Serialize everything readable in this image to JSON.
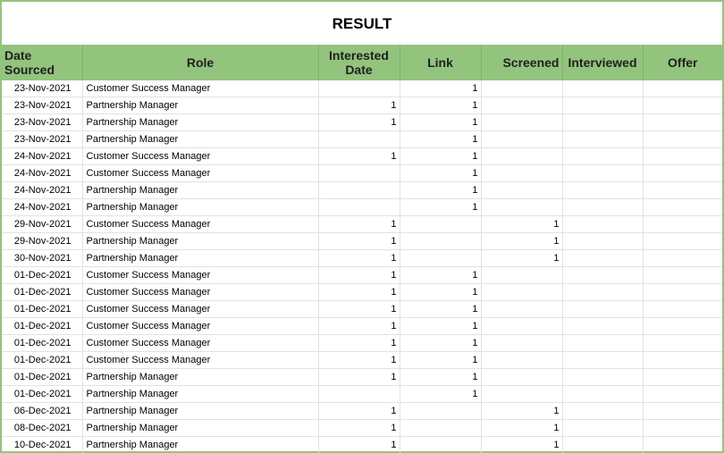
{
  "title": "RESULT",
  "colors": {
    "header_bg": "#93c47d",
    "border": "#93c47d",
    "grid": "#e2e2e2"
  },
  "columns": [
    "Date Sourced",
    "Role",
    "Interested Date",
    "Link",
    "Screened",
    "Interviewed",
    "Offer"
  ],
  "rows": [
    {
      "date": "23-Nov-2021",
      "role": "Customer Success Manager",
      "interested": "",
      "link": "1",
      "screened": "",
      "interviewed": "",
      "offer": ""
    },
    {
      "date": "23-Nov-2021",
      "role": "Partnership Manager",
      "interested": "1",
      "link": "1",
      "screened": "",
      "interviewed": "",
      "offer": ""
    },
    {
      "date": "23-Nov-2021",
      "role": "Partnership Manager",
      "interested": "1",
      "link": "1",
      "screened": "",
      "interviewed": "",
      "offer": ""
    },
    {
      "date": "23-Nov-2021",
      "role": "Partnership Manager",
      "interested": "",
      "link": "1",
      "screened": "",
      "interviewed": "",
      "offer": ""
    },
    {
      "date": "24-Nov-2021",
      "role": "Customer Success Manager",
      "interested": "1",
      "link": "1",
      "screened": "",
      "interviewed": "",
      "offer": ""
    },
    {
      "date": "24-Nov-2021",
      "role": "Customer Success Manager",
      "interested": "",
      "link": "1",
      "screened": "",
      "interviewed": "",
      "offer": ""
    },
    {
      "date": "24-Nov-2021",
      "role": "Partnership Manager",
      "interested": "",
      "link": "1",
      "screened": "",
      "interviewed": "",
      "offer": ""
    },
    {
      "date": "24-Nov-2021",
      "role": "Partnership Manager",
      "interested": "",
      "link": "1",
      "screened": "",
      "interviewed": "",
      "offer": ""
    },
    {
      "date": "29-Nov-2021",
      "role": "Customer Success Manager",
      "interested": "1",
      "link": "",
      "screened": "1",
      "interviewed": "",
      "offer": ""
    },
    {
      "date": "29-Nov-2021",
      "role": "Partnership Manager",
      "interested": "1",
      "link": "",
      "screened": "1",
      "interviewed": "",
      "offer": ""
    },
    {
      "date": "30-Nov-2021",
      "role": "Partnership Manager",
      "interested": "1",
      "link": "",
      "screened": "1",
      "interviewed": "",
      "offer": ""
    },
    {
      "date": "01-Dec-2021",
      "role": "Customer Success Manager",
      "interested": "1",
      "link": "1",
      "screened": "",
      "interviewed": "",
      "offer": ""
    },
    {
      "date": "01-Dec-2021",
      "role": "Customer Success Manager",
      "interested": "1",
      "link": "1",
      "screened": "",
      "interviewed": "",
      "offer": ""
    },
    {
      "date": "01-Dec-2021",
      "role": "Customer Success Manager",
      "interested": "1",
      "link": "1",
      "screened": "",
      "interviewed": "",
      "offer": ""
    },
    {
      "date": "01-Dec-2021",
      "role": "Customer Success Manager",
      "interested": "1",
      "link": "1",
      "screened": "",
      "interviewed": "",
      "offer": ""
    },
    {
      "date": "01-Dec-2021",
      "role": "Customer Success Manager",
      "interested": "1",
      "link": "1",
      "screened": "",
      "interviewed": "",
      "offer": ""
    },
    {
      "date": "01-Dec-2021",
      "role": "Customer Success Manager",
      "interested": "1",
      "link": "1",
      "screened": "",
      "interviewed": "",
      "offer": ""
    },
    {
      "date": "01-Dec-2021",
      "role": "Partnership Manager",
      "interested": "1",
      "link": "1",
      "screened": "",
      "interviewed": "",
      "offer": ""
    },
    {
      "date": "01-Dec-2021",
      "role": "Partnership Manager",
      "interested": "",
      "link": "1",
      "screened": "",
      "interviewed": "",
      "offer": ""
    },
    {
      "date": "06-Dec-2021",
      "role": "Partnership Manager",
      "interested": "1",
      "link": "",
      "screened": "1",
      "interviewed": "",
      "offer": ""
    },
    {
      "date": "08-Dec-2021",
      "role": "Partnership Manager",
      "interested": "1",
      "link": "",
      "screened": "1",
      "interviewed": "",
      "offer": ""
    },
    {
      "date": "10-Dec-2021",
      "role": "Partnership Manager",
      "interested": "1",
      "link": "",
      "screened": "1",
      "interviewed": "",
      "offer": ""
    }
  ]
}
